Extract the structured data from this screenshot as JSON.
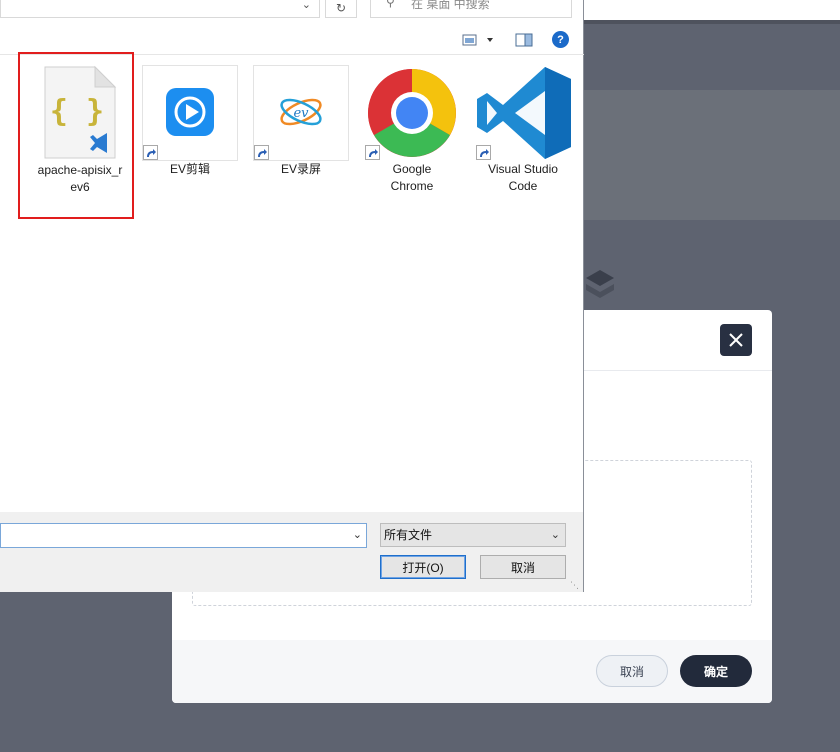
{
  "dialog": {
    "search_placeholder": "在 桌面 中搜索",
    "files": [
      {
        "name": "apache-apisix_r",
        "name2": "ev6",
        "icon": "json-file-icon"
      },
      {
        "name": "EV剪辑",
        "name2": "",
        "icon": "ev-editor-icon"
      },
      {
        "name": "EV录屏",
        "name2": "",
        "icon": "ev-recorder-icon"
      },
      {
        "name": "Google",
        "name2": "Chrome",
        "icon": "chrome-icon"
      },
      {
        "name": "Visual Studio",
        "name2": "Code",
        "icon": "vscode-icon"
      }
    ],
    "file_type_filter": "所有文件",
    "open_button": "打开(O)",
    "cancel_button": "取消",
    "filename_value": ""
  },
  "modal": {
    "cancel_button": "取消",
    "confirm_button": "确定"
  },
  "colors": {
    "highlight": "#e11d1d",
    "modal_primary": "#222a3b",
    "accent_blue": "#1b6ac9"
  }
}
